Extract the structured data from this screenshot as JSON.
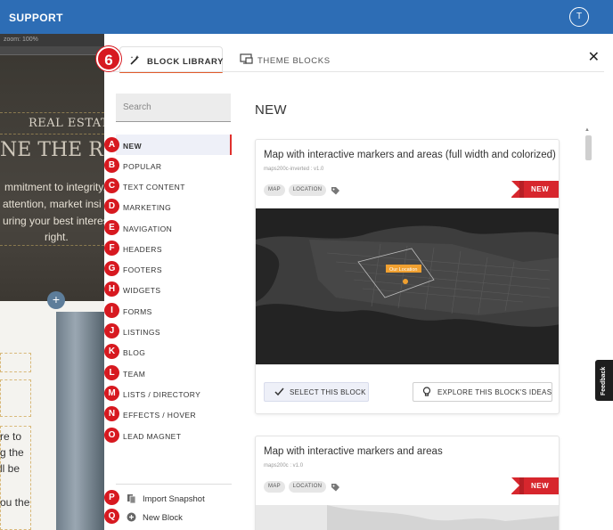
{
  "app": {
    "title": "SUPPORT",
    "user_initial": "T"
  },
  "editor": {
    "toolbar_text": "zoom: 100%",
    "real_estate": "REAL ESTATE",
    "headline": "NE THE RIGHT",
    "lines": [
      "mmitment to integrity,",
      "attention, market insi",
      "uring your best interes",
      "right."
    ],
    "lower_lines": [
      "re to",
      "g the",
      "ll be",
      "ou the"
    ]
  },
  "modal": {
    "tabs": [
      {
        "label": "BLOCK LIBRARY",
        "icon": "magic-wand-icon",
        "active": true
      },
      {
        "label": "THEME BLOCKS",
        "icon": "theme-blocks-icon",
        "active": false
      }
    ],
    "search_placeholder": "Search",
    "section_title": "NEW",
    "categories": [
      {
        "label": "NEW",
        "marker": "A",
        "active": true
      },
      {
        "label": "POPULAR",
        "marker": "B"
      },
      {
        "label": "TEXT CONTENT",
        "marker": "C"
      },
      {
        "label": "MARKETING",
        "marker": "D"
      },
      {
        "label": "NAVIGATION",
        "marker": "E"
      },
      {
        "label": "HEADERS",
        "marker": "F"
      },
      {
        "label": "FOOTERS",
        "marker": "G"
      },
      {
        "label": "WIDGETS",
        "marker": "H"
      },
      {
        "label": "FORMS",
        "marker": "I"
      },
      {
        "label": "LISTINGS",
        "marker": "J"
      },
      {
        "label": "BLOG",
        "marker": "K"
      },
      {
        "label": "TEAM",
        "marker": "L"
      },
      {
        "label": "LISTS / DIRECTORY",
        "marker": "M"
      },
      {
        "label": "EFFECTS / HOVER",
        "marker": "N"
      },
      {
        "label": "LEAD MAGNET",
        "marker": "O"
      }
    ],
    "sidebar_actions": [
      {
        "label": "Import Snapshot",
        "marker": "P",
        "icon": "import-icon"
      },
      {
        "label": "New Block",
        "marker": "Q",
        "icon": "plus-circle-icon"
      }
    ],
    "step_marker": "6",
    "cards": [
      {
        "title": "Map with interactive markers and areas (full width and colorized)",
        "subtitle": "maps200c-inverted : v1.0",
        "tags": [
          "MAP",
          "LOCATION"
        ],
        "badge": "NEW",
        "map_label": "Our Location",
        "select_label": "SELECT THIS BLOCK",
        "explore_label": "EXPLORE THIS BLOCK'S IDEAS"
      },
      {
        "title": "Map with interactive markers and areas",
        "subtitle": "maps200c : v1.0",
        "tags": [
          "MAP",
          "LOCATION"
        ],
        "badge": "NEW"
      }
    ],
    "feedback_label": "Feedback"
  },
  "colors": {
    "topbar": "#2d6db5",
    "accent": "#e15b2a",
    "badge": "#d7262d",
    "marker": "#d71920"
  }
}
